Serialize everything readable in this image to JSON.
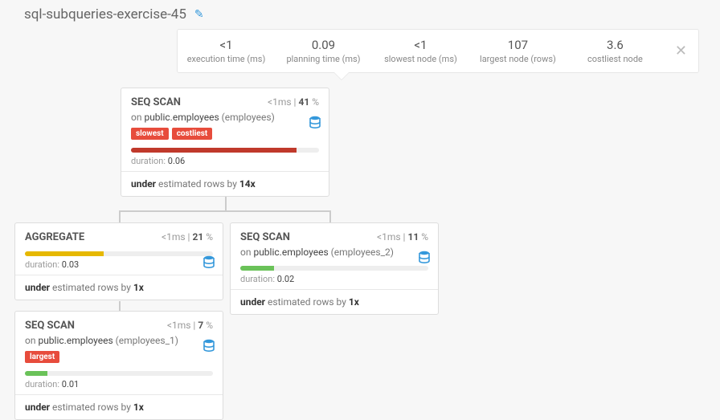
{
  "title": "sql-subqueries-exercise-45",
  "stats": {
    "execution_time": {
      "value": "<1",
      "label": "execution time (ms)"
    },
    "planning_time": {
      "value": "0.09",
      "label": "planning time (ms)"
    },
    "slowest_node": {
      "value": "<1",
      "label": "slowest node (ms)"
    },
    "largest_node": {
      "value": "107",
      "label": "largest node (rows)"
    },
    "costliest_node": {
      "value": "3.6",
      "label": "costliest node"
    }
  },
  "labels": {
    "duration_prefix": "duration: ",
    "under_prefix": "under",
    "under_mid": " estimated rows by ",
    "on_prefix": "on ",
    "time_unit": "ms",
    "sep": " | ",
    "x_suffix": "x",
    "pct": " %"
  },
  "nodes": {
    "n1": {
      "title": "SEQ SCAN",
      "time": "<1",
      "pct": "41",
      "on_table": "public.employees",
      "on_alias": "(employees)",
      "duration": "0.06",
      "under_factor": "14",
      "badges": [
        "slowest",
        "costliest"
      ],
      "bar_width": "88%",
      "bar_class": "bar-red"
    },
    "n2": {
      "title": "AGGREGATE",
      "time": "<1",
      "pct": "21",
      "duration": "0.03",
      "under_factor": "1",
      "bar_width": "42%",
      "bar_class": "bar-yellow"
    },
    "n3": {
      "title": "SEQ SCAN",
      "time": "<1",
      "pct": "11",
      "on_table": "public.employees",
      "on_alias": "(employees_2)",
      "duration": "0.02",
      "under_factor": "1",
      "bar_width": "18%",
      "bar_class": "bar-green"
    },
    "n4": {
      "title": "SEQ SCAN",
      "time": "<1",
      "pct": "7",
      "on_table": "public.employees",
      "on_alias": "(employees_1)",
      "duration": "0.01",
      "under_factor": "1",
      "badges": [
        "largest"
      ],
      "bar_width": "12%",
      "bar_class": "bar-green"
    }
  }
}
